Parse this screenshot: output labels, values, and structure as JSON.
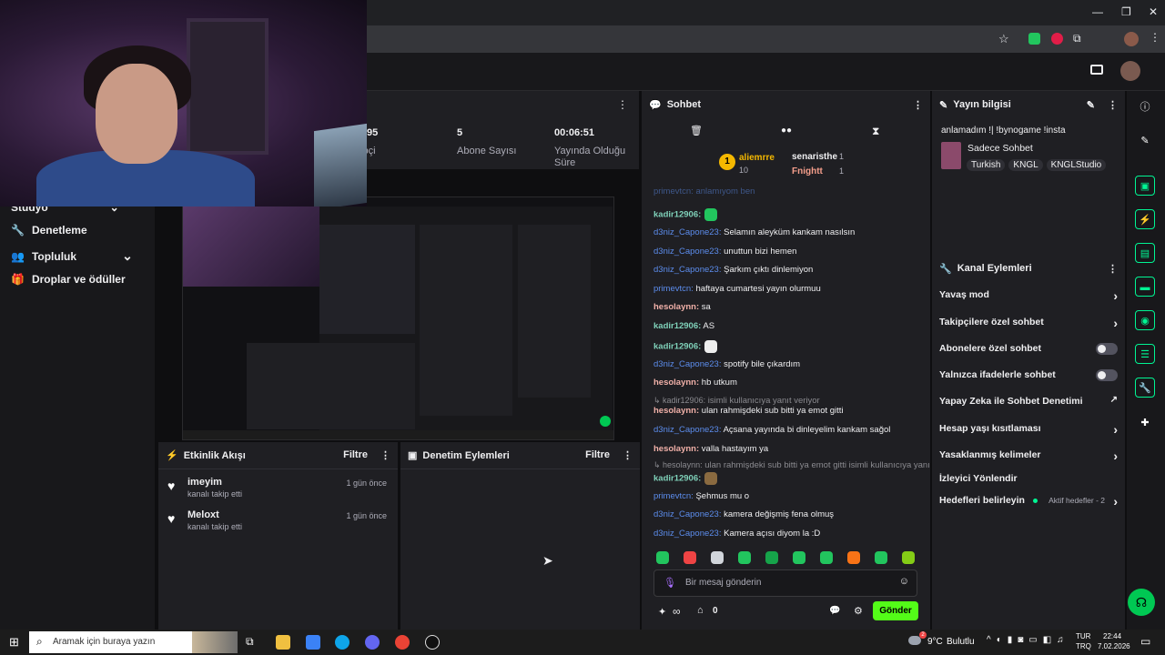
{
  "stats": [
    {
      "value": "95",
      "label": "Takipçi"
    },
    {
      "value": "5",
      "label": "Abone Sayısı"
    },
    {
      "value": "00:06:51",
      "label": "Yayında Olduğu Süre"
    }
  ],
  "nav": {
    "items": [
      {
        "label": "Stüdyo"
      },
      {
        "label": "Denetleme"
      },
      {
        "label": "Topluluk"
      },
      {
        "label": "Droplar ve ödüller"
      }
    ]
  },
  "activity": {
    "title": "Etkinlik Akışı",
    "filter": "Filtre",
    "items": [
      {
        "user": "imeyim",
        "text": "kanalı takip etti",
        "time": "1 gün önce"
      },
      {
        "user": "Meloxt",
        "text": "kanalı takip etti",
        "time": "1 gün önce"
      }
    ]
  },
  "moderation": {
    "title": "Denetim Eylemleri",
    "filter": "Filtre"
  },
  "chat": {
    "title": "Sohbet",
    "leaderboard": {
      "first_user": "aliemrre",
      "first_count": "10",
      "rank": "1",
      "second_user": "senaristhe",
      "second_count": "1",
      "third_user": "Fnightt",
      "third_count": "1"
    },
    "partial_top": "primevtcn: anlamıyom ben",
    "messages": [
      {
        "user": "kadir12906:",
        "text": "",
        "cls": "u-g"
      },
      {
        "user": "d3niz_Capone23:",
        "text": " Selamın aleyküm kankam nasılsın",
        "cls": "u-b"
      },
      {
        "user": "d3niz_Capone23:",
        "text": " unuttun bizi hemen",
        "cls": "u-b"
      },
      {
        "user": "d3niz_Capone23:",
        "text": " Şarkım çıktı dinlemiyon",
        "cls": "u-b"
      },
      {
        "user": "primevtcn:",
        "text": " haftaya cumartesi yayın olurmuu",
        "cls": "u-b"
      },
      {
        "user": "hesolaynn:",
        "text": " sa",
        "cls": "u-r"
      },
      {
        "user": "kadir12906:",
        "text": " AS",
        "cls": "u-g"
      },
      {
        "user": "kadir12906:",
        "text": "",
        "cls": "u-g"
      },
      {
        "user": "d3niz_Capone23:",
        "text": " spotify bile çıkardım",
        "cls": "u-b"
      },
      {
        "user": "hesolaynn:",
        "text": " hb utkum",
        "cls": "u-r"
      },
      {
        "user": "↳ kadir12906:",
        "text": " isimli kullanıcıya yanıt veriyor",
        "cls": "u-gr"
      },
      {
        "user": "hesolaynn:",
        "text": " ulan rahmişdeki sub bitti ya emot gitti",
        "cls": "u-r"
      },
      {
        "user": "d3niz_Capone23:",
        "text": " Açsana yayında bi dinleyelim kankam sağol",
        "cls": "u-b"
      },
      {
        "user": "hesolaynn:",
        "text": " valla hastayım ya",
        "cls": "u-r"
      },
      {
        "user": "↳ hesolaynn:",
        "text": " ulan rahmişdeki sub bitti ya emot gitti isimli kullanıcıya yanıt...",
        "cls": "u-gr"
      },
      {
        "user": "kadir12906:",
        "text": "",
        "cls": "u-g"
      },
      {
        "user": "primevtcn:",
        "text": " Şehmus mu o",
        "cls": "u-b"
      },
      {
        "user": "d3niz_Capone23:",
        "text": " kamera değişmiş fena olmuş",
        "cls": "u-b"
      },
      {
        "user": "d3niz_Capone23:",
        "text": " Kamera açısı diyom la :D",
        "cls": "u-b"
      }
    ],
    "input_placeholder": "Bir mesaj gönderin",
    "points": "∞",
    "gifts": "0",
    "send": "Gönder"
  },
  "stream_info": {
    "title": "Yayın bilgisi",
    "stream_title": "anlamadım !| !bynogame !insta",
    "category": "Sadece Sohbet",
    "tags": [
      "Turkish",
      "KNGL",
      "KNGLStudio"
    ]
  },
  "channel_actions": {
    "title": "Kanal Eylemleri",
    "items": [
      {
        "label": "Yavaş mod",
        "kind": "arrow"
      },
      {
        "label": "Takipçilere özel sohbet",
        "kind": "arrow"
      },
      {
        "label": "Abonelere özel sohbet",
        "kind": "toggle"
      },
      {
        "label": "Yalnızca ifadelerle sohbet",
        "kind": "toggle"
      },
      {
        "label": "Yapay Zeka ile Sohbet Denetimi",
        "kind": "external"
      },
      {
        "label": "Hesap yaşı kısıtlaması",
        "kind": "arrow"
      },
      {
        "label": "Yasaklanmış kelimeler",
        "kind": "arrow"
      },
      {
        "label": "İzleyici Yönlendir",
        "kind": "none"
      },
      {
        "label": "Hedefleri belirleyin",
        "kind": "arrow"
      }
    ],
    "goals_status": "Aktif hedefler - 2"
  },
  "taskbar": {
    "search_placeholder": "Aramak için buraya yazın",
    "weather_temp": "9°C",
    "weather_text": "Bulutlu",
    "weather_badge": "2",
    "lang_line1": "TUR",
    "lang_line2": "TRQ",
    "time": "22:44",
    "date": "7.02.2026"
  },
  "colors": {
    "accent": "#00f593",
    "send": "#53fc18",
    "bg": "#1f1f23"
  }
}
